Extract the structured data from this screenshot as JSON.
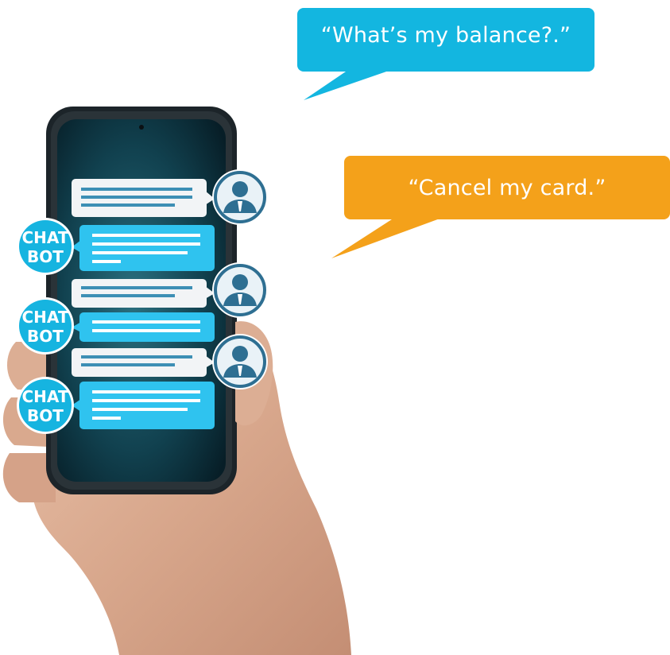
{
  "speech_bubbles": {
    "balance": {
      "text": "“What’s my balance?.”",
      "color": "#13b6e0"
    },
    "cancel": {
      "text": "“Cancel my card.”",
      "color": "#f4a11a"
    }
  },
  "chatbot_badge": {
    "line1": "CHAT",
    "line2": "BOT",
    "color": "#16b4e0"
  },
  "colors": {
    "phone_body": "#1c2429",
    "screen": "#0e3b4a",
    "user_message": "#f2f4f6",
    "bot_message": "#2fc3ef",
    "avatar_ring": "#2e6f92",
    "skin": "#d9a98e"
  }
}
